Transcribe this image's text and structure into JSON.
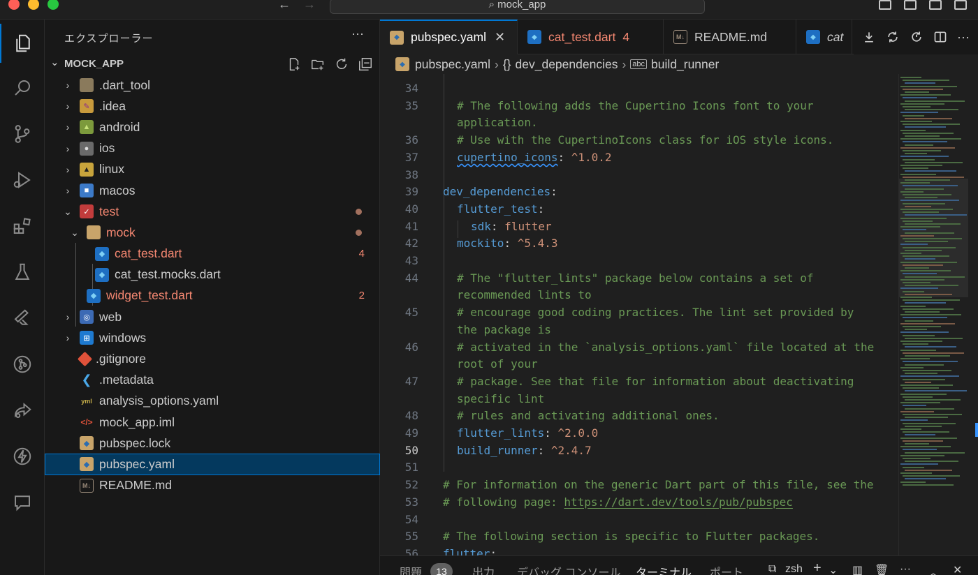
{
  "titlebar": {
    "search_text": "mock_app",
    "back_label": "←",
    "forward_label": "→"
  },
  "sidebar": {
    "title": "エクスプローラー",
    "more": "···",
    "project_name": "MOCK_APP",
    "tree": [
      {
        "label": ".dart_tool",
        "chev": "›",
        "icon": "folder-icon"
      },
      {
        "label": ".idea",
        "chev": "›",
        "icon": "idea-folder-icon"
      },
      {
        "label": "android",
        "chev": "›",
        "icon": "android-folder-icon"
      },
      {
        "label": "ios",
        "chev": "›",
        "icon": "ios-folder-icon"
      },
      {
        "label": "linux",
        "chev": "›",
        "icon": "linux-folder-icon"
      },
      {
        "label": "macos",
        "chev": "›",
        "icon": "macos-folder-icon"
      },
      {
        "label": "test",
        "chev": "⌄",
        "icon": "test-folder-icon"
      },
      {
        "label": "mock",
        "chev": "⌄",
        "icon": "open-folder-icon"
      },
      {
        "label": "cat_test.dart",
        "badge": "4",
        "icon": "dart-file-icon"
      },
      {
        "label": "cat_test.mocks.dart",
        "icon": "dart-file-icon"
      },
      {
        "label": "widget_test.dart",
        "badge": "2",
        "icon": "dart-file-icon"
      },
      {
        "label": "web",
        "chev": "›",
        "icon": "web-folder-icon"
      },
      {
        "label": "windows",
        "chev": "›",
        "icon": "windows-folder-icon"
      },
      {
        "label": ".gitignore",
        "icon": "git-icon"
      },
      {
        "label": ".metadata",
        "icon": "flutter-icon"
      },
      {
        "label": "analysis_options.yaml",
        "icon": "yaml-icon"
      },
      {
        "label": "mock_app.iml",
        "icon": "xml-icon"
      },
      {
        "label": "pubspec.lock",
        "icon": "pubspec-icon"
      },
      {
        "label": "pubspec.yaml",
        "icon": "pubspec-icon"
      },
      {
        "label": "README.md",
        "icon": "markdown-icon"
      }
    ]
  },
  "tabs": [
    {
      "label": "pubspec.yaml",
      "close": "✕"
    },
    {
      "label": "cat_test.dart",
      "count": "4"
    },
    {
      "label": "README.md"
    },
    {
      "label": "cat"
    }
  ],
  "breadcrumb": {
    "file": "pubspec.yaml",
    "braces": "{}",
    "section": "dev_dependencies",
    "abc": "abc",
    "item": "build_runner",
    "sep": "›"
  },
  "code_lines": [
    {
      "n": "34",
      "text": ""
    },
    {
      "n": "35",
      "text": "# The following adds the Cupertino Icons font to your"
    },
    {
      "n": "",
      "text": "application."
    },
    {
      "n": "",
      "text": "# Use with the CupertinoIcons class for iOS style icons."
    },
    {
      "n": "37",
      "key": "cupertino_icons",
      "val": "^1.0.2"
    },
    {
      "n": "38",
      "text": ""
    },
    {
      "n": "39",
      "key": "dev_dependencies",
      "val": ""
    },
    {
      "n": "40",
      "key": "flutter_test",
      "val": ""
    },
    {
      "n": "41",
      "key": "sdk",
      "val": "flutter"
    },
    {
      "n": "42",
      "key": "mockito",
      "val": "^5.4.3"
    },
    {
      "n": "43",
      "text": ""
    },
    {
      "n": "44",
      "text": "# The \"flutter_lints\" package below contains a set of"
    },
    {
      "n": "",
      "text": "recommended lints to"
    },
    {
      "n": "45",
      "text": "# encourage good coding practices. The lint set provided by"
    },
    {
      "n": "",
      "text": "the package is"
    },
    {
      "n": "46",
      "text": "# activated in the `analysis_options.yaml` file located at the"
    },
    {
      "n": "",
      "text": "root of your"
    },
    {
      "n": "47",
      "text": "# package. See that file for information about deactivating"
    },
    {
      "n": "",
      "text": "specific lint"
    },
    {
      "n": "48",
      "text": "# rules and activating additional ones."
    },
    {
      "n": "49",
      "key": "flutter_lints",
      "val": "^2.0.0"
    },
    {
      "n": "50",
      "key": "build_runner",
      "val": "^2.4.7"
    },
    {
      "n": "51",
      "text": ""
    },
    {
      "n": "52",
      "text": "# For information on the generic Dart part of this file, see the"
    },
    {
      "n": "53",
      "text": "# following page: ",
      "link": "https://dart.dev/tools/pub/pubspec"
    },
    {
      "n": "54",
      "text": ""
    },
    {
      "n": "55",
      "text": "# The following section is specific to Flutter packages."
    },
    {
      "n": "56",
      "key": "flutter",
      "val": ""
    }
  ],
  "line_36": "36",
  "panel": {
    "problems": "問題",
    "problems_count": "13",
    "output": "出力",
    "debug_console": "デバッグ コンソール",
    "terminal": "ターミナル",
    "ports": "ポート",
    "shell": "zsh",
    "add": "+",
    "more": "···"
  },
  "colors": {
    "accent": "#0078d4",
    "modified": "#f48771",
    "selected_bg": "#04395e",
    "comment": "#6a9955",
    "key": "#569cd6",
    "string": "#ce9178"
  }
}
